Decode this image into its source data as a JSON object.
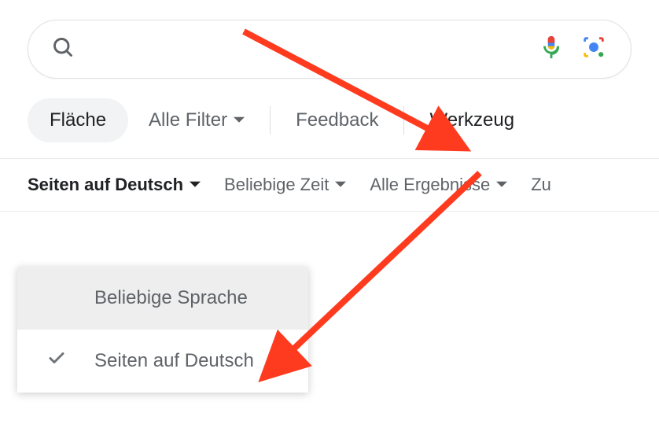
{
  "search": {
    "value": "",
    "placeholder": ""
  },
  "filters": {
    "pill": "Fläche",
    "all_filters": "Alle Filter",
    "feedback": "Feedback",
    "tools": "Werkzeug"
  },
  "tools_row": {
    "language": "Seiten auf Deutsch",
    "time": "Beliebige Zeit",
    "results": "Alle Ergebnisse",
    "reset": "Zu"
  },
  "dropdown": {
    "any_language": "Beliebige Sprache",
    "pages_german": "Seiten auf Deutsch"
  }
}
